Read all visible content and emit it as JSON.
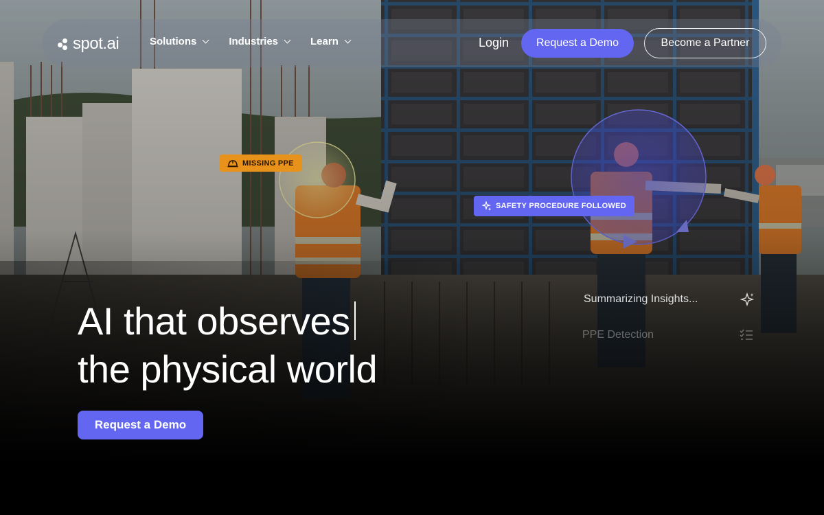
{
  "brand": {
    "logo_text": "spot.ai"
  },
  "nav": {
    "items": [
      {
        "label": "Solutions"
      },
      {
        "label": "Industries"
      },
      {
        "label": "Learn"
      }
    ],
    "login": "Login",
    "request_demo": "Request a Demo",
    "become_partner": "Become a Partner"
  },
  "overlays": {
    "missing_ppe": "MISSING PPE",
    "safety_followed": "SAFETY PROCEDURE FOLLOWED"
  },
  "insights": {
    "summarizing": "Summarizing Insights...",
    "ppe_detection": "PPE Detection"
  },
  "hero": {
    "line1": "AI that observes",
    "line2": "the physical world",
    "cta": "Request a Demo"
  },
  "colors": {
    "accent": "#6266f0",
    "warning": "#e8921c"
  },
  "icons": [
    "helmet-icon",
    "sparkle-icon",
    "checklist-icon",
    "chevron-down-icon"
  ]
}
